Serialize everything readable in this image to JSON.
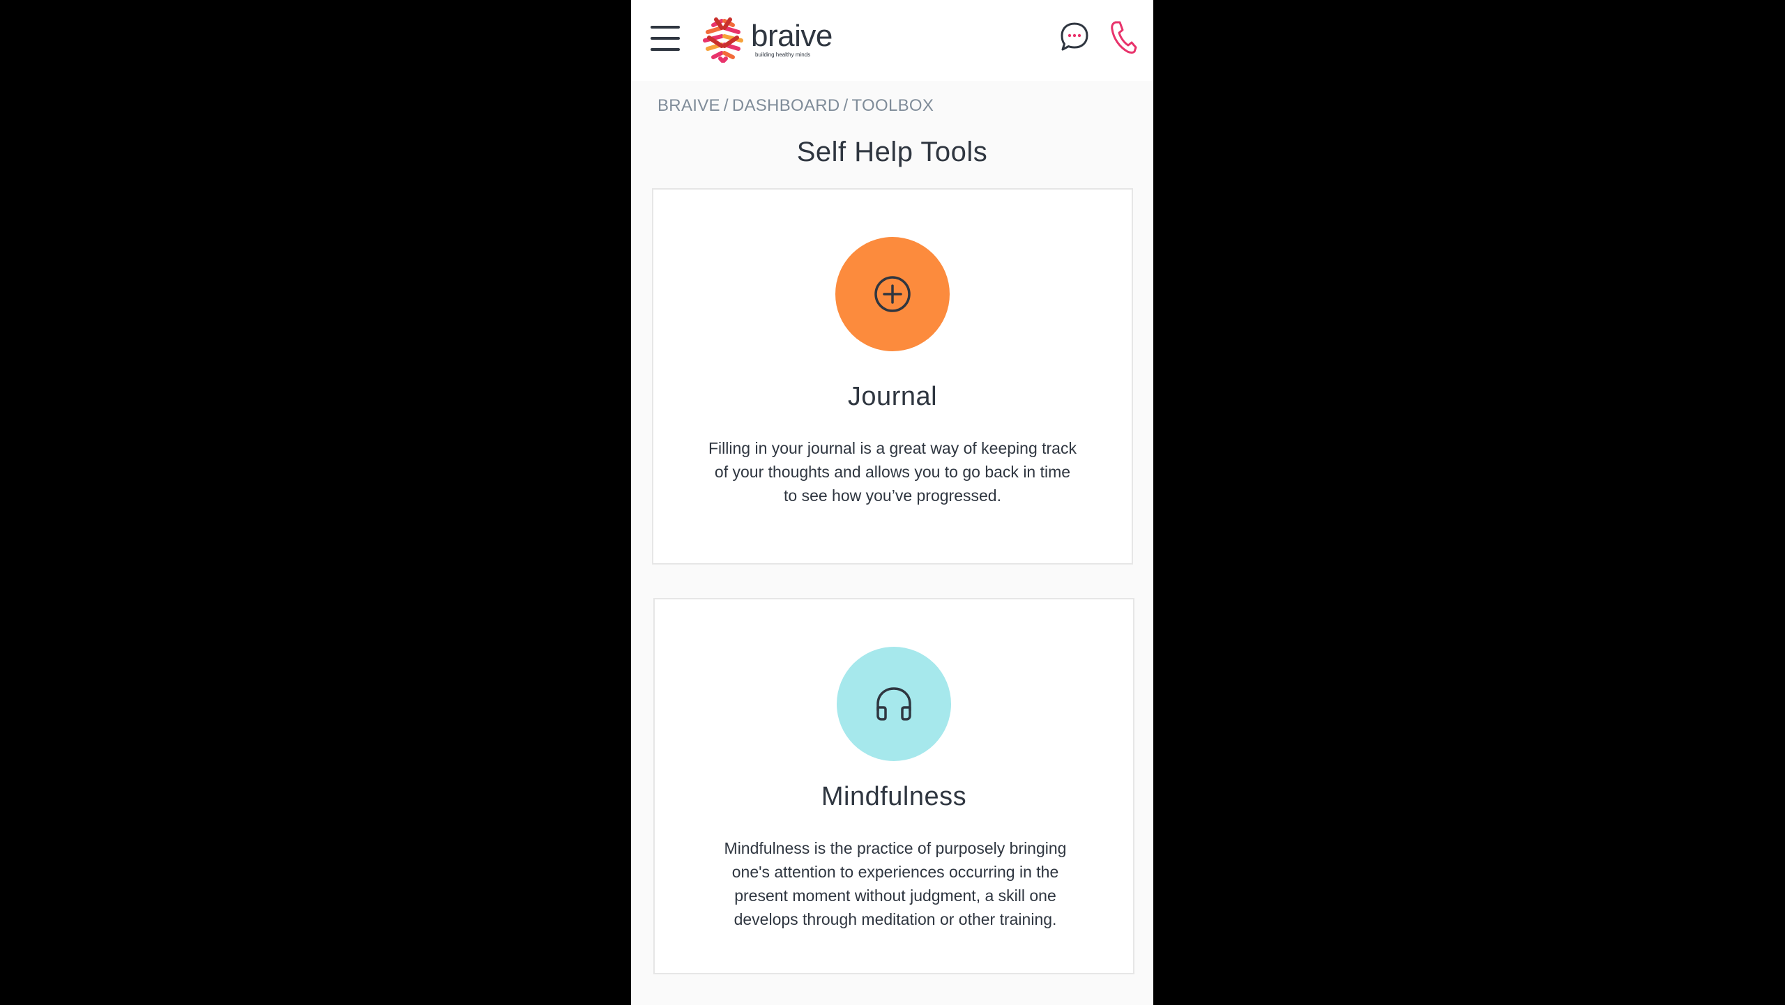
{
  "header": {
    "brand_name": "braive",
    "brand_tagline": "building healthy minds",
    "icons": {
      "menu": "hamburger-menu-icon",
      "chat": "chat-bubble-icon",
      "phone": "phone-icon"
    },
    "colors": {
      "phone_accent": "#e8336b",
      "chat_accent": "#e8336b"
    }
  },
  "breadcrumb": {
    "items": [
      "BRAIVE",
      "DASHBOARD",
      "TOOLBOX"
    ],
    "separator": "/"
  },
  "page": {
    "title": "Self Help Tools"
  },
  "tools": [
    {
      "title": "Journal",
      "description": "Filling in your journal is a great way of keeping track of your thoughts and allows you to go back in time to see how you’ve progressed.",
      "icon": "plus-circle-icon",
      "color": "#fc8b3d"
    },
    {
      "title": "Mindfulness",
      "description": "Mindfulness is the practice of purposely bringing one's attention to experiences occurring in the present moment without judgment, a skill one develops through meditation or other training.",
      "icon": "headphones-icon",
      "color": "#a6e8ec"
    }
  ]
}
